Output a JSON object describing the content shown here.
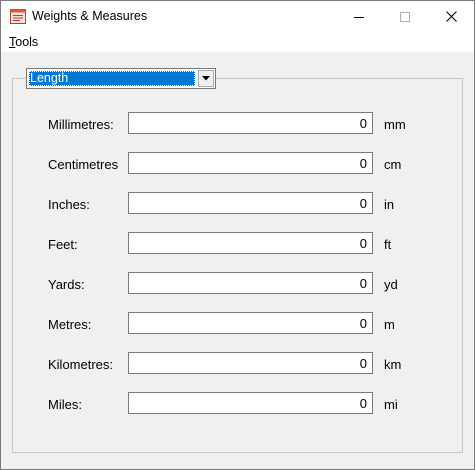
{
  "window": {
    "title": "Weights & Measures"
  },
  "menu": {
    "tools_mnemonic": "T",
    "tools_rest": "ools"
  },
  "category": {
    "selected": "Length",
    "icon": "chevron-down-icon"
  },
  "rows": [
    {
      "label": "Millimetres:",
      "value": "0",
      "unit": "mm"
    },
    {
      "label": "Centimetres",
      "value": "0",
      "unit": "cm"
    },
    {
      "label": "Inches:",
      "value": "0",
      "unit": "in"
    },
    {
      "label": "Feet:",
      "value": "0",
      "unit": "ft"
    },
    {
      "label": "Yards:",
      "value": "0",
      "unit": "yd"
    },
    {
      "label": "Metres:",
      "value": "0",
      "unit": "m"
    },
    {
      "label": "Kilometres:",
      "value": "0",
      "unit": "km"
    },
    {
      "label": "Miles:",
      "value": "0",
      "unit": "mi"
    }
  ]
}
